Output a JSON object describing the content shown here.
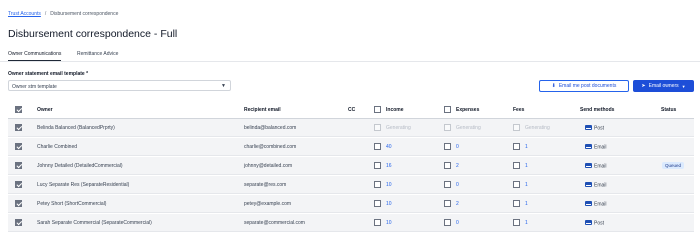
{
  "breadcrumb": {
    "link": "Trust Accounts",
    "separator": "/",
    "current": "Disbursement correspondence"
  },
  "page": {
    "title": "Disbursement correspondence - Full"
  },
  "tabs": [
    {
      "label": "Owner Communications",
      "active": true
    },
    {
      "label": "Remittance Advice",
      "active": false
    }
  ],
  "template": {
    "label": "Owner statement email template *",
    "value": "Owner stm template"
  },
  "buttons": {
    "email_me": "Email me post documents",
    "email_owners": "Email owners"
  },
  "table": {
    "headers": {
      "owner": "Owner",
      "recipient": "Recipient email",
      "cc": "CC",
      "income": "Income",
      "expenses": "Expenses",
      "fees": "Fees",
      "send": "Send methods",
      "status": "Status"
    },
    "rows": [
      {
        "owner": "Belinda Balanced (BalancedPrprty)",
        "email": "belinda@balanced.com",
        "income": "Generating",
        "expenses": "Generating",
        "fees": "Generating",
        "method": "Post",
        "status": "",
        "pending": true
      },
      {
        "owner": "Charlie Combined",
        "email": "charlie@combined.com",
        "income": "40",
        "expenses": "0",
        "fees": "1",
        "method": "Email",
        "status": "",
        "pending": false
      },
      {
        "owner": "Johnny Detailed (DetailedCommercial)",
        "email": "johnny@detailed.com",
        "income": "16",
        "expenses": "2",
        "fees": "1",
        "method": "Email",
        "status": "Queued",
        "pending": false
      },
      {
        "owner": "Lucy Separate Res (SeparateResidential)",
        "email": "separate@res.com",
        "income": "10",
        "expenses": "0",
        "fees": "1",
        "method": "Email",
        "status": "",
        "pending": false
      },
      {
        "owner": "Petey Short (ShortCommercial)",
        "email": "petey@example.com",
        "income": "10",
        "expenses": "2",
        "fees": "1",
        "method": "Email",
        "status": "",
        "pending": false
      },
      {
        "owner": "Sarah Separate Commercial (SeparateCommercial)",
        "email": "separate@commercial.com",
        "income": "10",
        "expenses": "0",
        "fees": "1",
        "method": "Post",
        "status": "",
        "pending": false
      }
    ]
  }
}
